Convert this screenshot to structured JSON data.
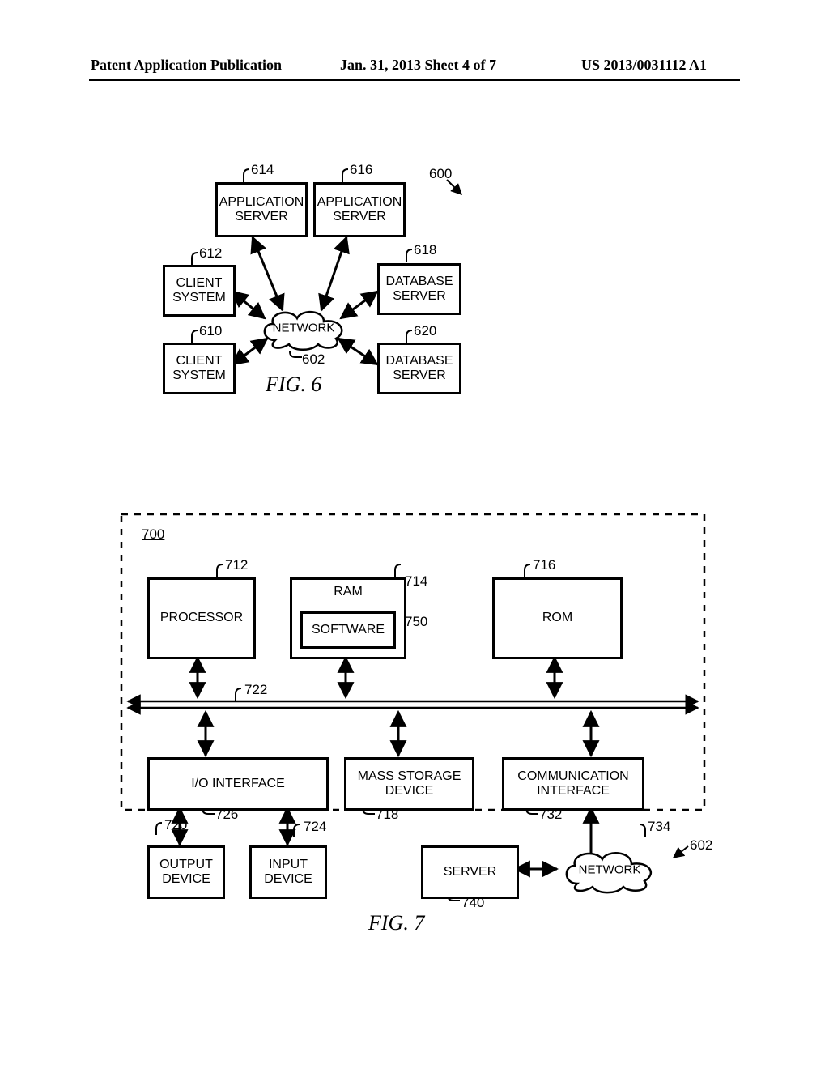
{
  "header": {
    "left": "Patent Application Publication",
    "center": "Jan. 31, 2013   Sheet 4 of 7",
    "right": "US 2013/0031112 A1"
  },
  "fig6": {
    "label": "FIG. 6",
    "ref_600": "600",
    "ref_602": "602",
    "ref_610": "610",
    "ref_612": "612",
    "ref_614": "614",
    "ref_616": "616",
    "ref_618": "618",
    "ref_620": "620",
    "network": "NETWORK",
    "client_system": "CLIENT\nSYSTEM",
    "app_server": "APPLICATION\nSERVER",
    "db_server": "DATABASE\nSERVER"
  },
  "fig7": {
    "label": "FIG. 7",
    "ref_700": "700",
    "ref_712": "712",
    "ref_714": "714",
    "ref_716": "716",
    "ref_718": "718",
    "ref_720": "720",
    "ref_722": "722",
    "ref_724": "724",
    "ref_726": "726",
    "ref_732": "732",
    "ref_734": "734",
    "ref_740": "740",
    "ref_750": "750",
    "ref_602": "602",
    "processor": "PROCESSOR",
    "ram": "RAM",
    "software": "SOFTWARE",
    "rom": "ROM",
    "io_interface": "I/O INTERFACE",
    "mass_storage": "MASS STORAGE\nDEVICE",
    "comm_interface": "COMMUNICATION\nINTERFACE",
    "output_device": "OUTPUT\nDEVICE",
    "input_device": "INPUT\nDEVICE",
    "server": "SERVER",
    "network": "NETWORK"
  }
}
